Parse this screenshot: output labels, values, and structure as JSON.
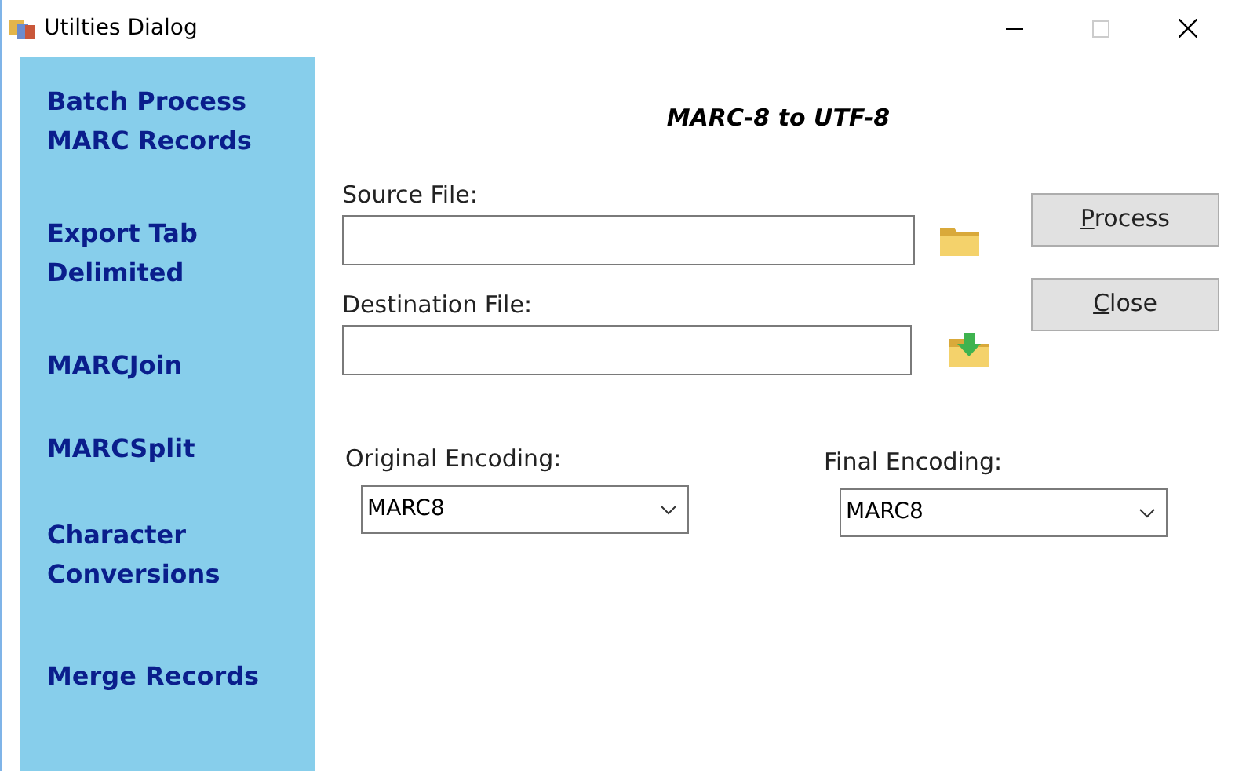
{
  "window": {
    "title": "Utilties Dialog",
    "maximize_disabled": true
  },
  "sidebar": {
    "items": [
      {
        "label": "Batch Process MARC Records"
      },
      {
        "label": "Export Tab Delimited"
      },
      {
        "label": "MARCJoin"
      },
      {
        "label": "MARCSplit"
      },
      {
        "label": "Character Conversions"
      },
      {
        "label": "Merge Records"
      }
    ]
  },
  "heading": "MARC-8 to UTF-8",
  "source": {
    "label": "Source File:"
  },
  "destination": {
    "label": "Destination File:"
  },
  "buttons": [
    {
      "label": "Process"
    },
    {
      "label": "Close"
    }
  ],
  "original_encoding": {
    "label": "Original Encoding:",
    "value": "MARC8"
  },
  "final_encoding": {
    "label": "Final Encoding:",
    "value": "MARC8"
  }
}
